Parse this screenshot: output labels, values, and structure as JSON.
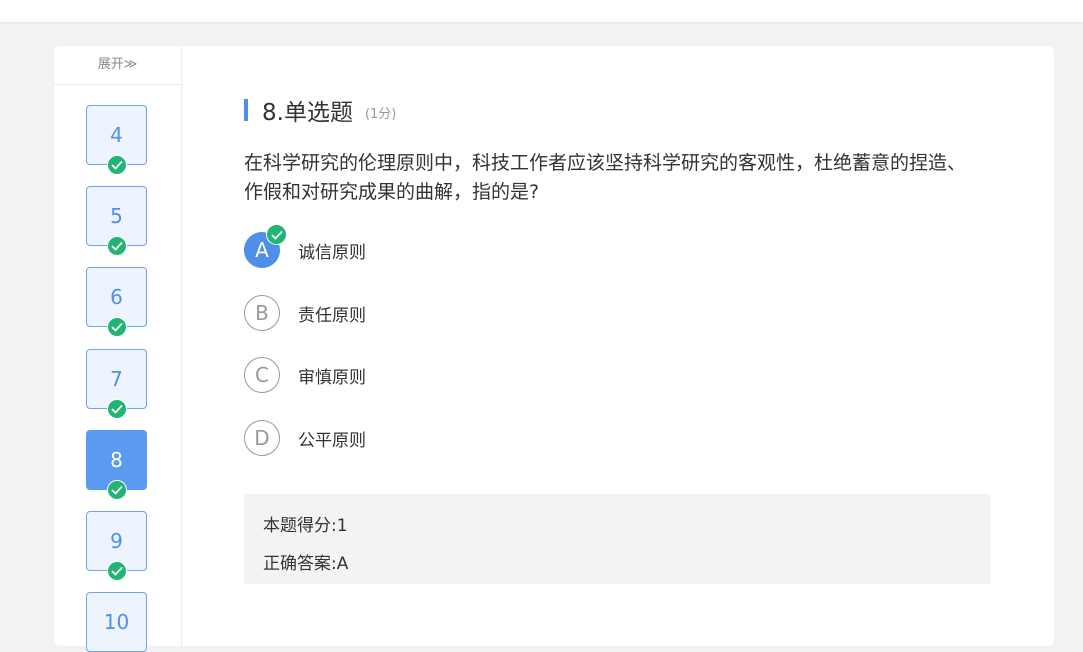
{
  "sidebar": {
    "expand_label": "展开≫",
    "items": [
      {
        "number": "4",
        "answered": true
      },
      {
        "number": "5",
        "answered": true
      },
      {
        "number": "6",
        "answered": true
      },
      {
        "number": "7",
        "answered": true
      },
      {
        "number": "8",
        "answered": true,
        "active": true
      },
      {
        "number": "9",
        "answered": true
      },
      {
        "number": "10",
        "answered": false
      }
    ]
  },
  "question": {
    "title": "8.单选题",
    "score": "(1分)",
    "stem": "在科学研究的伦理原则中，科技工作者应该坚持科学研究的客观性，杜绝蓄意的捏造、作假和对研究成果的曲解，指的是?",
    "options": [
      {
        "letter": "A",
        "text": "诚信原则",
        "selected": true
      },
      {
        "letter": "B",
        "text": "责任原则"
      },
      {
        "letter": "C",
        "text": "审慎原则"
      },
      {
        "letter": "D",
        "text": "公平原则"
      }
    ]
  },
  "result": {
    "score_label": "本题得分:",
    "score_value": "1",
    "answer_label": "正确答案:",
    "answer_value": "A"
  },
  "colors": {
    "accent": "#4f8fe8",
    "check_green": "#21b573",
    "background": "#f2f2f2"
  },
  "icons": {
    "answered": "check-circle-icon",
    "expand": "double-chevron-right-icon"
  }
}
